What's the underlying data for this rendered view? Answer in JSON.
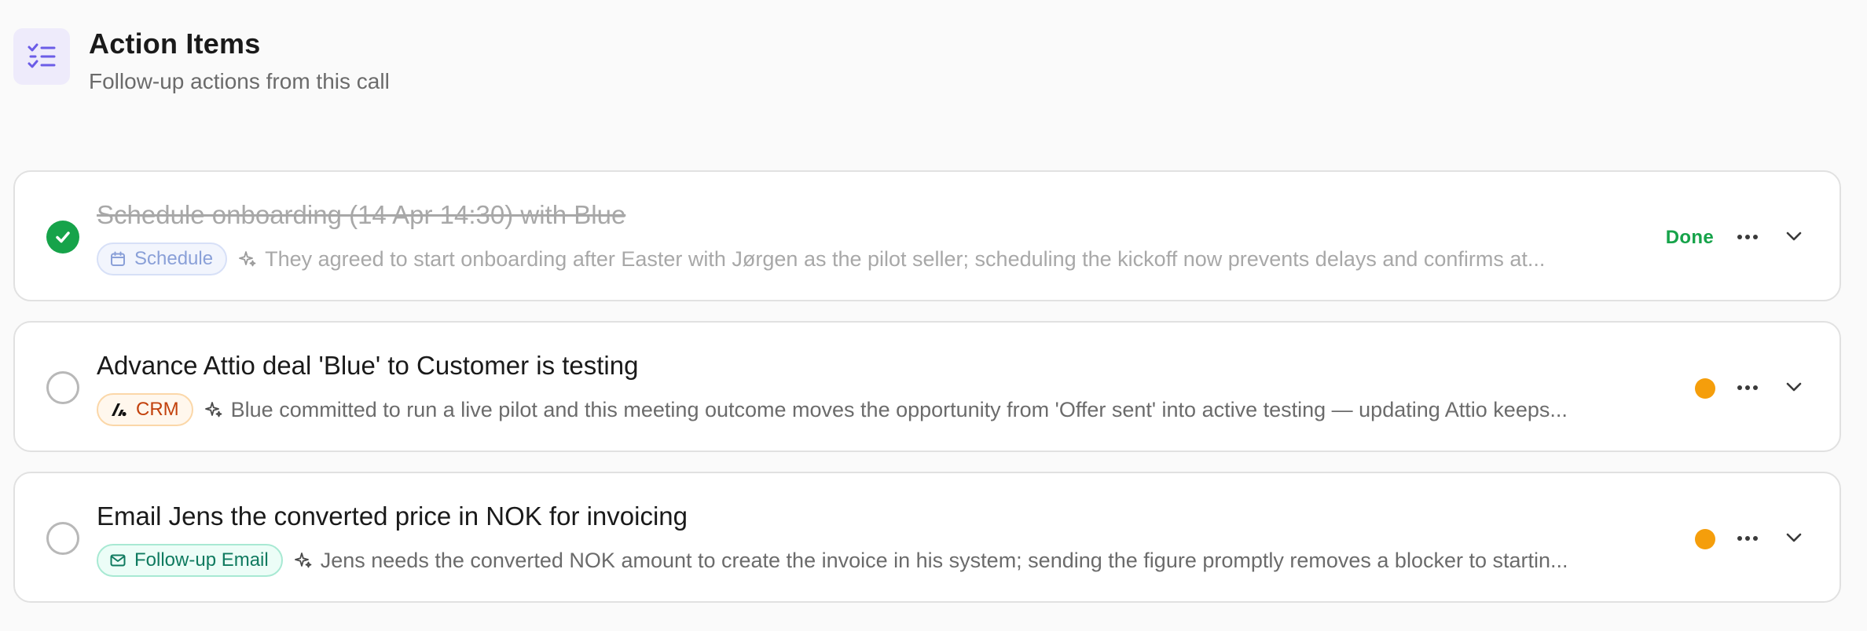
{
  "header": {
    "title": "Action Items",
    "subtitle": "Follow-up actions from this call",
    "icon": "checklist-icon"
  },
  "items": [
    {
      "title": "Schedule onboarding (14 Apr 14:30) with Blue",
      "completed": true,
      "badge": {
        "label": "Schedule",
        "icon": "calendar-icon"
      },
      "reason": "They agreed to start onboarding after Easter with Jørgen as the pilot seller; scheduling the kickoff now prevents delays and confirms at...",
      "status": "Done"
    },
    {
      "title": "Advance Attio deal 'Blue' to Customer is testing",
      "completed": false,
      "badge": {
        "label": "CRM",
        "icon": "attio-logo-icon"
      },
      "reason": "Blue committed to run a live pilot and this meeting outcome moves the opportunity from 'Offer sent' into active testing — updating Attio keeps...",
      "status_color": "#f59e0b"
    },
    {
      "title": "Email Jens the converted price in NOK for invoicing",
      "completed": false,
      "badge": {
        "label": "Follow-up Email",
        "icon": "mail-icon"
      },
      "reason": "Jens needs the converted NOK amount to create the invoice in his system; sending the figure promptly removes a blocker to startin...",
      "status_color": "#f59e0b"
    }
  ],
  "colors": {
    "accent_purple": "#6b5ce7",
    "done_green": "#16a34a",
    "pending_orange": "#f59e0b"
  }
}
